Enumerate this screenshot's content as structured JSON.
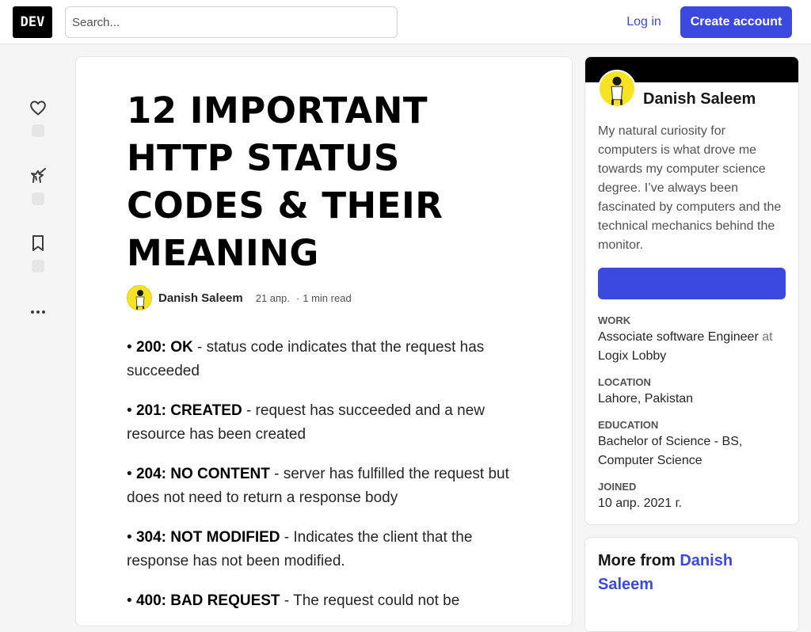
{
  "header": {
    "logo_text": "DEV",
    "search_placeholder": "Search...",
    "login_label": "Log in",
    "create_account_label": "Create account"
  },
  "reactions": {
    "items": [
      {
        "icon": "heart-icon"
      },
      {
        "icon": "unicorn-icon"
      },
      {
        "icon": "bookmark-icon"
      },
      {
        "icon": "more-horizontal-icon"
      }
    ]
  },
  "article": {
    "title": "12 IMPORTANT HTTP STATUS CODES & THEIR MEANING",
    "author": "Danish Saleem",
    "date": "21 апр.",
    "separator": "·",
    "read_time": "1 min read",
    "status_codes": [
      {
        "code": "200: OK",
        "description": " - status code indicates that the request has succeeded"
      },
      {
        "code": "201: CREATED",
        "description": " - request has succeeded and a new resource has been created"
      },
      {
        "code": "204: NO CONTENT",
        "description": " - server has fulfilled the request but does not need to return a response body"
      },
      {
        "code": "304: NOT MODIFIED",
        "description": " - Indicates the client that the response has not been modified."
      },
      {
        "code": "400: BAD REQUEST",
        "description": " - The request could not be"
      }
    ]
  },
  "profile": {
    "name": "Danish Saleem",
    "bio": "My natural curiosity for computers is what drove me towards my computer science degree. I’ve always been fascinated by computers and the technical mechanics behind the monitor.",
    "follow_label": "",
    "work_label": "WORK",
    "work_value": "Associate software Engineer",
    "work_at": " at ",
    "work_company": "Logix Lobby",
    "location_label": "LOCATION",
    "location_value": "Lahore, Pakistan",
    "education_label": "EDUCATION",
    "education_value": "Bachelor of Science - BS, Computer Science",
    "joined_label": "JOINED",
    "joined_value": "10 апр. 2021 г."
  },
  "more_from": {
    "prefix": "More from",
    "author": "Danish Saleem"
  },
  "colors": {
    "accent": "#3b49df",
    "avatar_bg": "#f7e321"
  }
}
